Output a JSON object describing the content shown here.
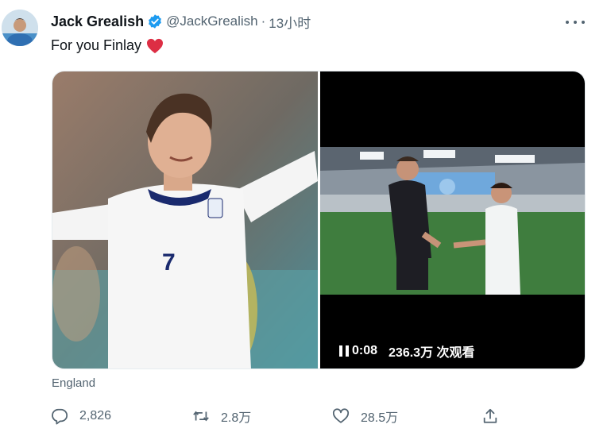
{
  "tweet": {
    "author_name": "Jack Grealish",
    "author_handle": "@JackGrealish",
    "separator": "·",
    "timestamp": "13小时",
    "text": "For you Finlay",
    "location": "England"
  },
  "video": {
    "duration": "0:08",
    "views": "236.3万 次观看"
  },
  "actions": {
    "replies": "2,826",
    "retweets": "2.8万",
    "likes": "28.5万"
  },
  "colors": {
    "text_primary": "#0f1419",
    "text_secondary": "#536471",
    "verified": "#1d9bf0",
    "heart": "#e0245e"
  },
  "icons": [
    "verified-badge-icon",
    "more-icon",
    "heart-emoji-icon",
    "pause-icon",
    "reply-icon",
    "retweet-icon",
    "like-icon",
    "share-icon"
  ]
}
